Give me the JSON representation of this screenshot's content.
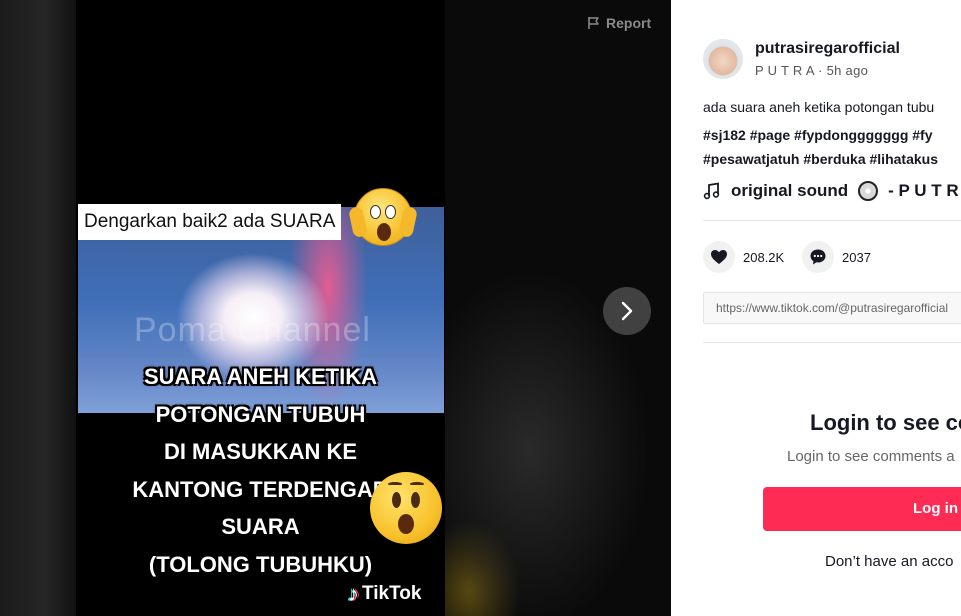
{
  "report": {
    "label": "Report",
    "icon": "flag-icon"
  },
  "video": {
    "top_caption": "Dengarkan baik2 ada SUARA",
    "watermark": "Poma Channel",
    "caption_lines": [
      "SUARA ANEH KETIKA",
      "POTONGAN TUBUH",
      "DI MASUKKAN KE",
      "KANTONG TERDENGAR",
      "SUARA",
      "(TOLONG TUBUHKU)"
    ],
    "brand": "TikTok"
  },
  "nav": {
    "next_icon": "chevron-right-icon"
  },
  "author": {
    "username": "putrasiregarofficial",
    "nickname": "P U T R A",
    "time": "5h ago"
  },
  "post": {
    "description": "ada suara aneh ketika potongan tubu",
    "tags_line1": "#sj182 #page #fypdonggggggg #fy",
    "tags_line2": "#pesawatjatuh #berduka #lihatakus",
    "sound": "original sound",
    "sound_suffix": "- P U T R A"
  },
  "stats": {
    "likes": "208.2K",
    "comments": "2037"
  },
  "share": {
    "url": "https://www.tiktok.com/@putrasiregarofficial"
  },
  "login": {
    "title": "Login to see co",
    "subtitle": "Login to see comments a",
    "button": "Log in",
    "signup_prompt": "Don’t have an acco"
  },
  "colors": {
    "accent": "#fe2c55",
    "text": "#161823"
  }
}
